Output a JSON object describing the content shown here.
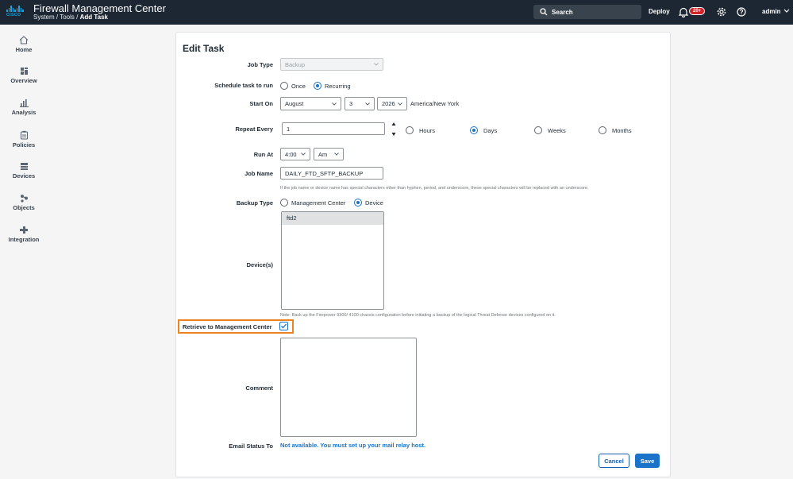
{
  "header": {
    "logo_text": "CISCO",
    "app_title": "Firewall Management Center",
    "breadcrumb_path": "System / Tools /",
    "breadcrumb_current": "Add Task",
    "search_label": "Search",
    "deploy_label": "Deploy",
    "notification_badge": "20+",
    "user_label": "admin"
  },
  "sidebar": {
    "items": [
      {
        "label": "Home",
        "icon": "home-icon"
      },
      {
        "label": "Overview",
        "icon": "overview-icon"
      },
      {
        "label": "Analysis",
        "icon": "analysis-icon"
      },
      {
        "label": "Policies",
        "icon": "policies-icon"
      },
      {
        "label": "Devices",
        "icon": "devices-icon"
      },
      {
        "label": "Objects",
        "icon": "objects-icon"
      },
      {
        "label": "Integration",
        "icon": "integration-icon"
      }
    ]
  },
  "form": {
    "title": "Edit Task",
    "job_type": {
      "label": "Job Type",
      "value": "Backup"
    },
    "schedule": {
      "label": "Schedule task to run",
      "options": [
        "Once",
        "Recurring"
      ],
      "selected": "Recurring"
    },
    "start_on": {
      "label": "Start On",
      "month": "August",
      "day": "3",
      "year": "2026",
      "timezone": "America/New York"
    },
    "repeat_every": {
      "label": "Repeat Every",
      "value": "1",
      "units": [
        "Hours",
        "Days",
        "Weeks",
        "Months"
      ],
      "selected": "Days"
    },
    "run_at": {
      "label": "Run At",
      "time": "4:00",
      "meridiem": "Am"
    },
    "job_name": {
      "label": "Job Name",
      "value": "DAILY_FTD_SFTP_BACKUP",
      "hint": "If the job name or device name has special characters other than hyphen, period, and underscore, these special characters will be replaced with an underscore."
    },
    "backup_type": {
      "label": "Backup Type",
      "options": [
        "Management Center",
        "Device"
      ],
      "selected": "Device"
    },
    "devices": {
      "label": "Device(s)",
      "items": [
        "ftd2"
      ],
      "note": "Note: Back up the Firepower 9300/ 4100 chassis configuration before initiating a backup of the logical Threat Defense devices configured on it."
    },
    "retrieve": {
      "label": "Retrieve to Management Center",
      "checked": true
    },
    "comment": {
      "label": "Comment",
      "value": ""
    },
    "email": {
      "label": "Email Status To",
      "link": "Not available. You must set up your mail relay host."
    },
    "buttons": {
      "cancel": "Cancel",
      "save": "Save"
    }
  },
  "colors": {
    "accent": "#1a73c9",
    "header_bg": "#1c2733",
    "highlight": "#f0821e"
  }
}
